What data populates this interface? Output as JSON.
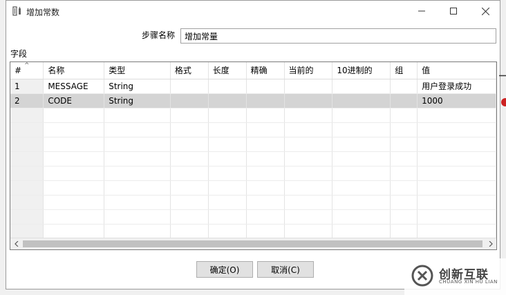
{
  "window": {
    "title": "增加常数",
    "app_icon": "kettle-step-icon"
  },
  "form": {
    "step_name_label": "步骤名称",
    "step_name_value": "增加常量",
    "fields_label": "字段"
  },
  "table": {
    "headers": [
      "#",
      "名称",
      "类型",
      "格式",
      "长度",
      "精确",
      "当前的",
      "10进制的",
      "组",
      "值"
    ],
    "rows": [
      {
        "num": "1",
        "name": "MESSAGE",
        "type": "String",
        "format": "",
        "length": "",
        "precision": "",
        "currency": "",
        "decimal": "",
        "group": "",
        "value": "用户登录成功"
      },
      {
        "num": "2",
        "name": "CODE",
        "type": "String",
        "format": "",
        "length": "",
        "precision": "",
        "currency": "",
        "decimal": "",
        "group": "",
        "value": "1000"
      }
    ],
    "selected_row": 2
  },
  "buttons": {
    "ok": "确定(O)",
    "cancel": "取消(C)"
  },
  "watermark": {
    "text": "创新互联",
    "sub": "CHUANG XIN HU LIAN"
  }
}
